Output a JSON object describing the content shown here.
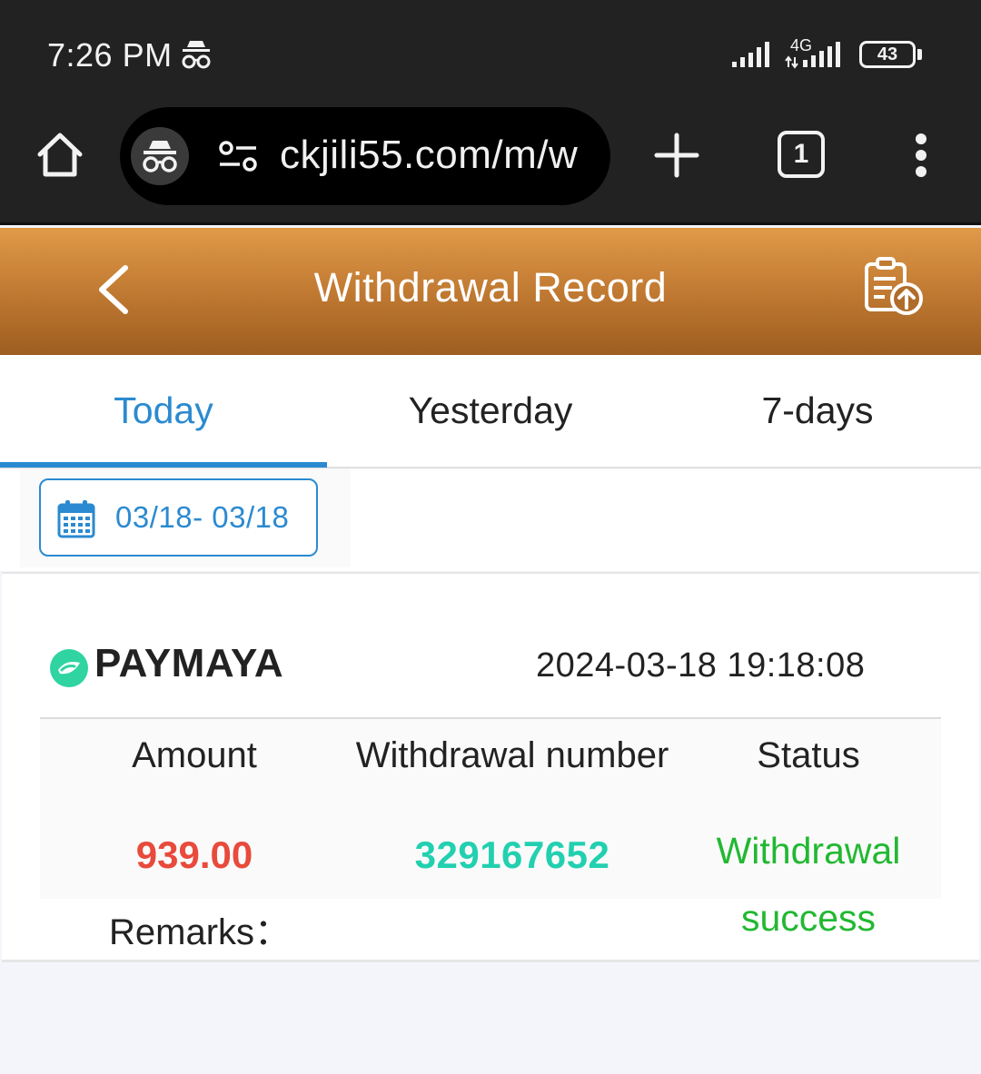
{
  "status_bar": {
    "time": "7:26 PM",
    "network": "4G",
    "battery": "43"
  },
  "browser": {
    "url": "ckjili55.com/m/w",
    "tab_count": "1"
  },
  "header": {
    "title": "Withdrawal Record"
  },
  "tabs": [
    {
      "label": "Today",
      "active": true
    },
    {
      "label": "Yesterday",
      "active": false
    },
    {
      "label": "7-days",
      "active": false
    }
  ],
  "filter": {
    "date_range": "03/18- 03/18"
  },
  "record": {
    "method": "PAYMAYA",
    "datetime": "2024-03-18 19:18:08",
    "columns": {
      "amount": "Amount",
      "number": "Withdrawal number",
      "status": "Status"
    },
    "amount": "939.00",
    "number": "329167652",
    "status": "Withdrawal success",
    "remarks_label": "Remarks："
  },
  "colors": {
    "accent": "#2b8ad0",
    "header_top": "#e09a48",
    "header_bottom": "#9d5e20",
    "amount": "#e84a3b",
    "number": "#22d0b0",
    "status": "#22b832"
  },
  "icons": [
    "incognito-icon",
    "signal-icon",
    "battery-icon",
    "home-icon",
    "tune-icon",
    "plus-icon",
    "tabs-icon",
    "more-vert-icon",
    "back-icon",
    "export-record-icon",
    "calendar-icon",
    "paymaya-logo-icon"
  ]
}
